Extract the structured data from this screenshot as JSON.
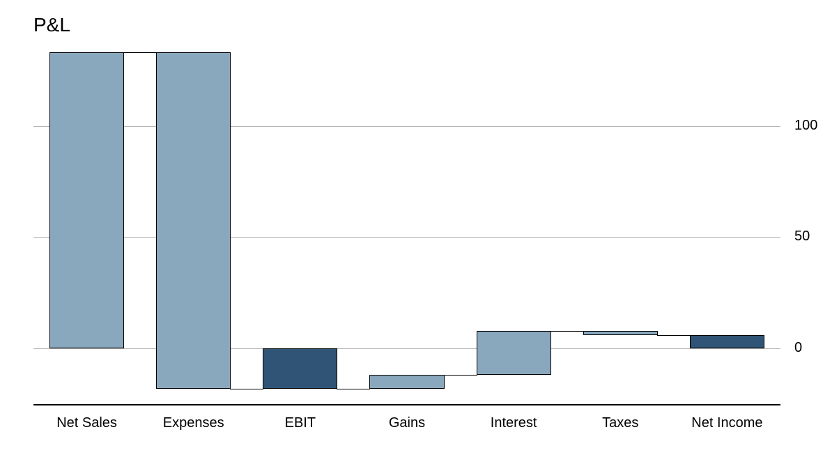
{
  "chart_data": {
    "type": "bar",
    "title": "P&L",
    "categories": [
      "Net Sales",
      "Expenses",
      "EBIT",
      "Gains",
      "Interest",
      "Taxes",
      "Net Income"
    ],
    "waterfall": [
      {
        "label": "Net Sales",
        "start": 0,
        "end": 133,
        "total": false,
        "color": "light"
      },
      {
        "label": "Expenses",
        "start": 133,
        "end": -18,
        "total": false,
        "color": "light"
      },
      {
        "label": "EBIT",
        "start": 0,
        "end": -18,
        "total": true,
        "color": "dark"
      },
      {
        "label": "Gains",
        "start": -18,
        "end": -12,
        "total": false,
        "color": "light"
      },
      {
        "label": "Interest",
        "start": -12,
        "end": 8,
        "total": false,
        "color": "light"
      },
      {
        "label": "Taxes",
        "start": 8,
        "end": 6,
        "total": false,
        "color": "light"
      },
      {
        "label": "Net Income",
        "start": 0,
        "end": 6,
        "total": true,
        "color": "dark"
      }
    ],
    "yticks": [
      0,
      50,
      100
    ],
    "ylim": [
      -25,
      134
    ],
    "xlabel": "",
    "ylabel": ""
  }
}
